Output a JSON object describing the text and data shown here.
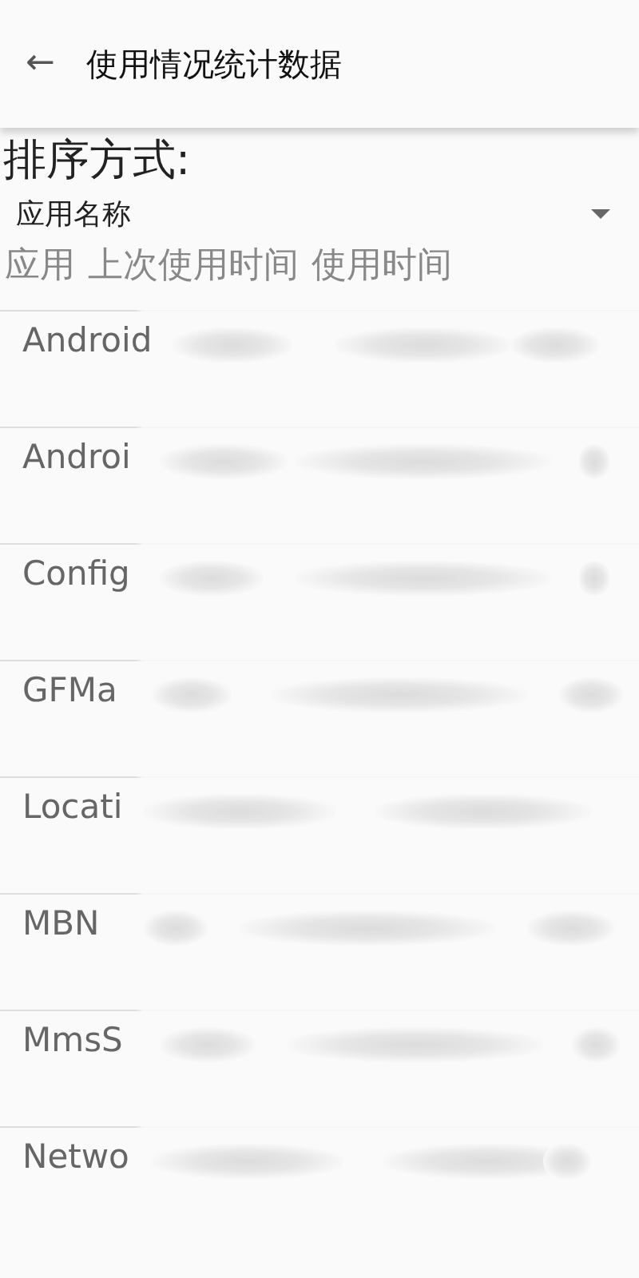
{
  "app_bar": {
    "back_icon": "←",
    "title": "使用情况统计数据"
  },
  "sort": {
    "label": "排序方式:",
    "value": "应用名称"
  },
  "table": {
    "columns": [
      "应用",
      "上次使用时间",
      "使用时间"
    ],
    "rows": [
      {
        "app": "Android"
      },
      {
        "app": "Androi"
      },
      {
        "app": "Config"
      },
      {
        "app": "GFMa"
      },
      {
        "app": "Locati"
      },
      {
        "app": "MBN"
      },
      {
        "app": "MmsS"
      },
      {
        "app": "Netwo"
      }
    ]
  }
}
